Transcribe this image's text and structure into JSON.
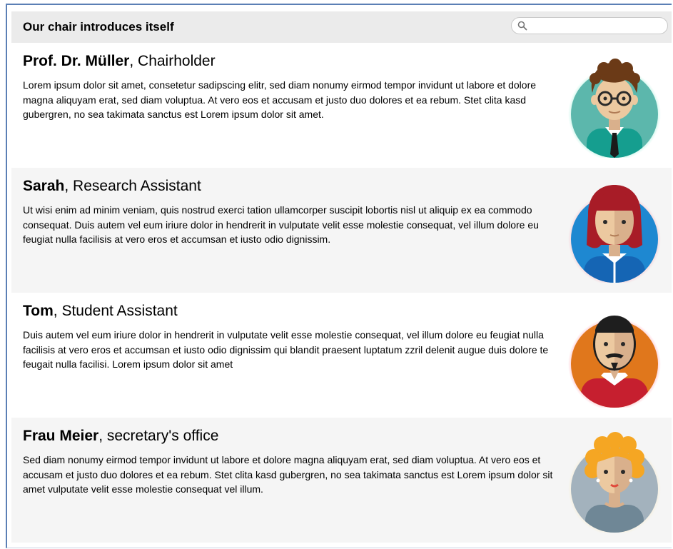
{
  "header": {
    "title": "Our chair introduces itself",
    "search": {
      "placeholder": "",
      "value": ""
    }
  },
  "people": [
    {
      "name": "Prof. Dr. Müller",
      "role": ", Chairholder",
      "description": "Lorem ipsum dolor sit amet, consetetur sadipscing elitr, sed diam nonumy eirmod tempor invidunt ut labore et dolore magna aliquyam erat, sed diam voluptua. At vero eos et accusam et justo duo dolores et ea rebum. Stet clita kasd gubergren, no sea takimata sanctus est Lorem ipsum dolor sit amet.",
      "avatar_color": "#5cb7ac"
    },
    {
      "name": "Sarah",
      "role": ", Research Assistant",
      "description": "Ut wisi enim ad minim veniam, quis nostrud exerci tation ullamcorper suscipit lobortis nisl ut aliquip ex ea commodo consequat. Duis autem vel eum iriure dolor in hendrerit in vulputate velit esse molestie consequat, vel illum dolore eu feugiat nulla facilisis at vero eros et accumsan et iusto odio dignissim.",
      "avatar_color": "#1e88d1"
    },
    {
      "name": "Tom",
      "role": ", Student Assistant",
      "description": "Duis autem vel eum iriure dolor in hendrerit in vulputate velit esse molestie consequat, vel illum dolore eu feugiat nulla facilisis at vero eros et accumsan et iusto odio dignissim qui blandit praesent luptatum zzril delenit augue duis dolore te feugait nulla facilisi. Lorem ipsum dolor sit amet",
      "avatar_color": "#e0771c"
    },
    {
      "name": "Frau Meier",
      "role": ", secretary's office",
      "description": "Sed diam nonumy eirmod tempor invidunt ut labore et dolore magna aliquyam erat, sed diam voluptua. At vero eos et accusam et justo duo dolores et ea rebum. Stet clita kasd gubergren, no sea takimata sanctus est Lorem ipsum dolor sit amet vulputate velit esse molestie consequat vel illum.",
      "avatar_color": "#a3b2bd"
    }
  ],
  "icons": {
    "search": "search-icon",
    "avatars": [
      "professor-avatar-icon",
      "woman-red-hair-avatar-icon",
      "man-beard-avatar-icon",
      "woman-blonde-hair-avatar-icon"
    ]
  }
}
